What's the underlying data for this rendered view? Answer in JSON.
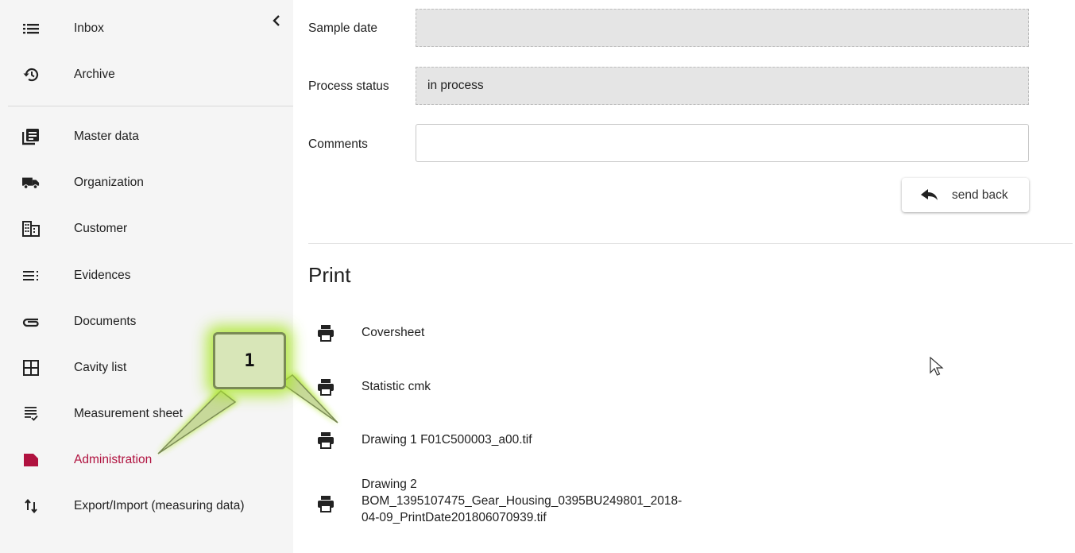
{
  "sidebar": {
    "items": [
      {
        "label": "Inbox",
        "icon": "list-icon"
      },
      {
        "label": "Archive",
        "icon": "history-icon"
      },
      {
        "label": "Master data",
        "icon": "library-icon"
      },
      {
        "label": "Organization",
        "icon": "truck-icon"
      },
      {
        "label": "Customer",
        "icon": "building-icon"
      },
      {
        "label": "Evidences",
        "icon": "list-dots-icon"
      },
      {
        "label": "Documents",
        "icon": "paperclip-icon"
      },
      {
        "label": "Cavity list",
        "icon": "grid-icon"
      },
      {
        "label": "Measurement sheet",
        "icon": "checklist-icon"
      },
      {
        "label": "Administration",
        "icon": "folder-icon"
      },
      {
        "label": "Export/Import (measuring data)",
        "icon": "swap-vertical-icon"
      }
    ],
    "active_color": "#b0123f"
  },
  "form": {
    "sample_date": {
      "label": "Sample date",
      "value": ""
    },
    "process_status": {
      "label": "Process status",
      "value": "in process"
    },
    "comments": {
      "label": "Comments",
      "value": ""
    },
    "send_back_label": "send back"
  },
  "print": {
    "title": "Print",
    "items": [
      {
        "label": "Coversheet"
      },
      {
        "label": "Statistic cmk"
      },
      {
        "label": "Drawing 1 F01C500003_a00.tif"
      },
      {
        "label": "Drawing 2\nBOM_1395107475_Gear_Housing_0395BU249801_2018-\n04-09_PrintDate201806070939.tif"
      }
    ]
  },
  "callout": {
    "number": "1",
    "glow_color": "#aee628"
  }
}
